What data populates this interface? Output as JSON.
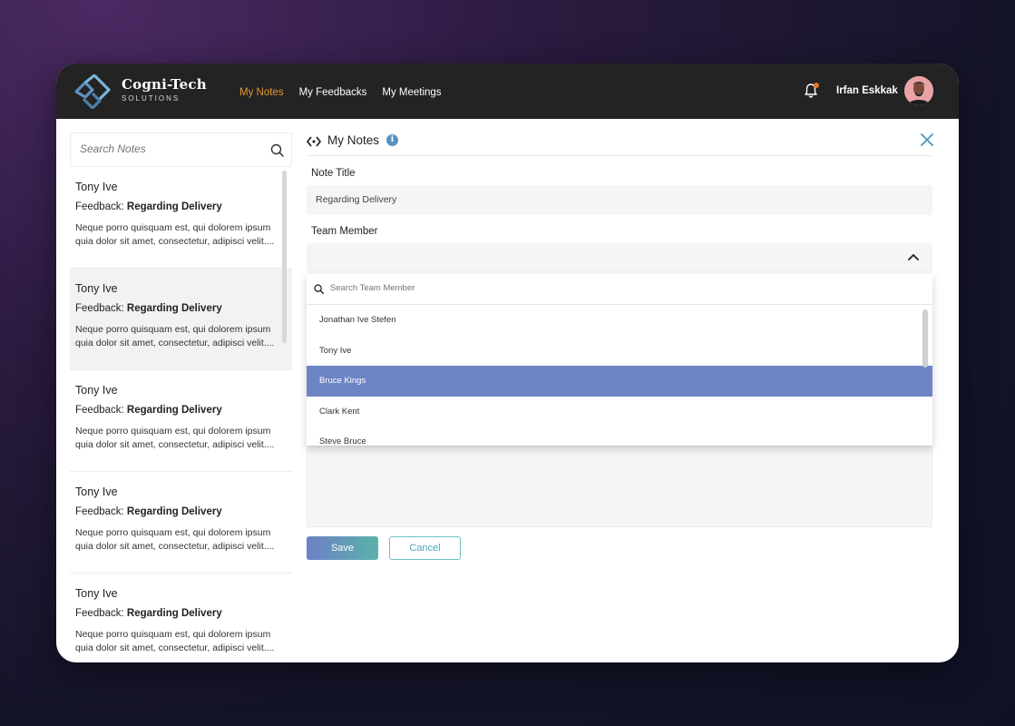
{
  "brand": {
    "name": "Cogni-Tech",
    "subtitle": "SOLUTIONS"
  },
  "nav": {
    "items": [
      {
        "label": "My Notes",
        "active": true
      },
      {
        "label": "My Feedbacks",
        "active": false
      },
      {
        "label": "My Meetings",
        "active": false
      }
    ]
  },
  "user": {
    "name": "Irfan Eskkak"
  },
  "colors": {
    "accent": "#e8952e",
    "highlight": "#6d84c5",
    "header": "#232323",
    "info": "#5a92c2"
  },
  "sidebar": {
    "search_placeholder": "Search Notes",
    "notes": [
      {
        "name": "Tony Ive",
        "feedback_prefix": "Feedback:",
        "feedback_title": "Regarding Delivery",
        "body": "Neque porro quisquam est, qui dolorem ipsum quia dolor sit amet, consectetur, adipisci velit....",
        "selected": false
      },
      {
        "name": "Tony Ive",
        "feedback_prefix": "Feedback:",
        "feedback_title": "Regarding Delivery",
        "body": "Neque porro quisquam est, qui dolorem ipsum quia dolor sit amet, consectetur, adipisci velit....",
        "selected": true
      },
      {
        "name": "Tony Ive",
        "feedback_prefix": "Feedback:",
        "feedback_title": "Regarding Delivery",
        "body": "Neque porro quisquam est, qui dolorem ipsum quia dolor sit amet, consectetur, adipisci velit....",
        "selected": false
      },
      {
        "name": "Tony Ive",
        "feedback_prefix": "Feedback:",
        "feedback_title": "Regarding Delivery",
        "body": "Neque porro quisquam est, qui dolorem ipsum quia dolor sit amet, consectetur, adipisci velit....",
        "selected": false
      },
      {
        "name": "Tony Ive",
        "feedback_prefix": "Feedback:",
        "feedback_title": "Regarding Delivery",
        "body": "Neque porro quisquam est, qui dolorem ipsum quia dolor sit amet, consectetur, adipisci velit....",
        "selected": false
      }
    ]
  },
  "main": {
    "title": "My Notes",
    "note_title_label": "Note Title",
    "note_title_value": "Regarding Delivery",
    "team_member_label": "Team Member",
    "team_member_value": "",
    "dropdown": {
      "search_placeholder": "Search Team Member",
      "options": [
        {
          "label": "Jonathan Ive Stefen",
          "highlight": false
        },
        {
          "label": "Tony Ive",
          "highlight": false
        },
        {
          "label": "Bruce Kings",
          "highlight": true
        },
        {
          "label": "Clark Kent",
          "highlight": false
        },
        {
          "label": "Steve Bruce",
          "highlight": false
        }
      ]
    },
    "save_label": "Save",
    "cancel_label": "Cancel"
  },
  "icons": {
    "logo": "cogni-tech-logo-icon",
    "search": "search-icon",
    "bell": "bell-icon",
    "code": "code-icon",
    "info": "info-icon",
    "close": "close-icon",
    "chevron": "chevron-up-icon"
  }
}
